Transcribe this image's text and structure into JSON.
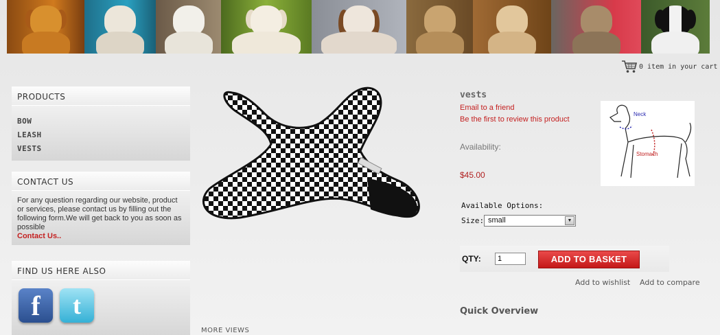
{
  "cart": {
    "text": "0 item in your cart"
  },
  "sidebar": {
    "products": {
      "title": "PRODUCTS",
      "items": [
        "BOW",
        "LEASH",
        "VESTS"
      ]
    },
    "contact": {
      "title": "CONTACT US",
      "text": "For any question regarding our website, product or services, please contact us by filling out the following form.We will get back to you as soon as possible",
      "link": "Contact Us.."
    },
    "find": {
      "title": "FIND US HERE ALSO",
      "facebook_icon": "f",
      "twitter_icon": "t"
    }
  },
  "product": {
    "name": "vests",
    "email_link": "Email to a friend",
    "review_link": "Be the first to review this product",
    "availability": "Availability:",
    "price": "$45.00",
    "options_label": "Available Options:",
    "size_label": "Size:",
    "size_value": "small",
    "qty_label": "QTY:",
    "qty_value": "1",
    "add_button": "ADD TO BASKET",
    "wishlist": "Add to wishlist",
    "compare": "Add to compare",
    "quick_overview": "Quick Overview",
    "more_views": "MORE VIEWS",
    "chart_neck": "Neck",
    "chart_stomach": "Stomach"
  },
  "colors": {
    "accent_red": "#c42020",
    "button_red": "#d42a2a"
  }
}
